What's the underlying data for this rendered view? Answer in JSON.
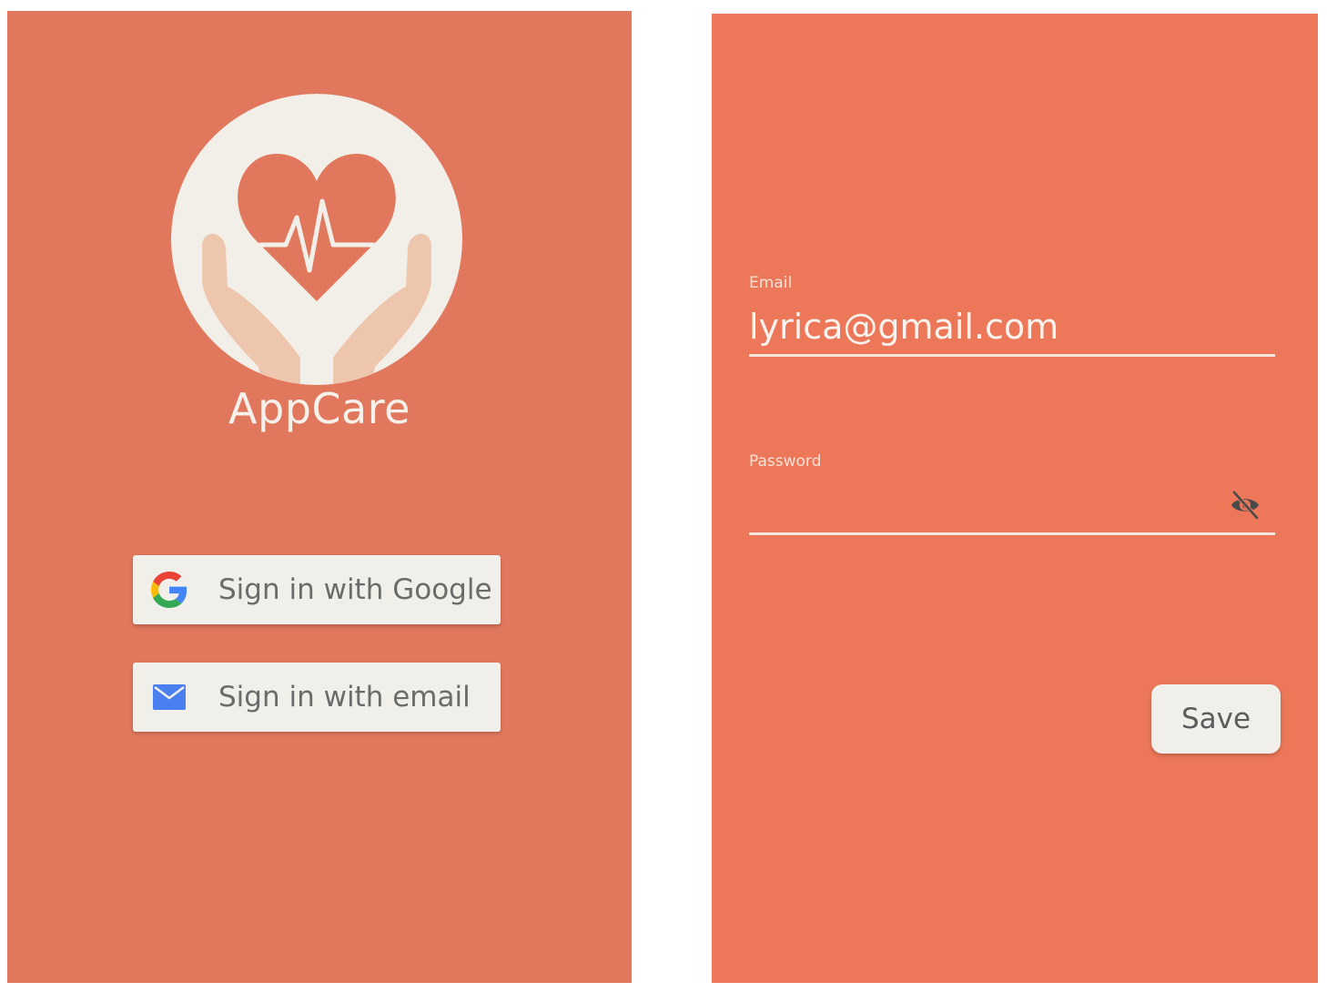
{
  "colors": {
    "login_background": "#e1785e",
    "form_background": "#ec7759",
    "logo_circle": "#f2efe8",
    "button_background": "#f0efea",
    "google_blue": "#4285f4",
    "google_red": "#ea4335",
    "google_yellow": "#fbbc05",
    "google_green": "#34a853",
    "email_icon_blue": "#4a7ff0"
  },
  "login": {
    "app_name": "AppCare",
    "logo_icon": "heart-in-hands-icon",
    "google_button": {
      "label": "Sign in with Google",
      "icon": "google-g-icon"
    },
    "email_button": {
      "label": "Sign in with email",
      "icon": "envelope-icon"
    }
  },
  "form": {
    "email": {
      "label": "Email",
      "value": "lyrica@gmail.com"
    },
    "password": {
      "label": "Password",
      "value": "",
      "toggle_icon": "eye-off-icon"
    },
    "save_label": "Save"
  }
}
